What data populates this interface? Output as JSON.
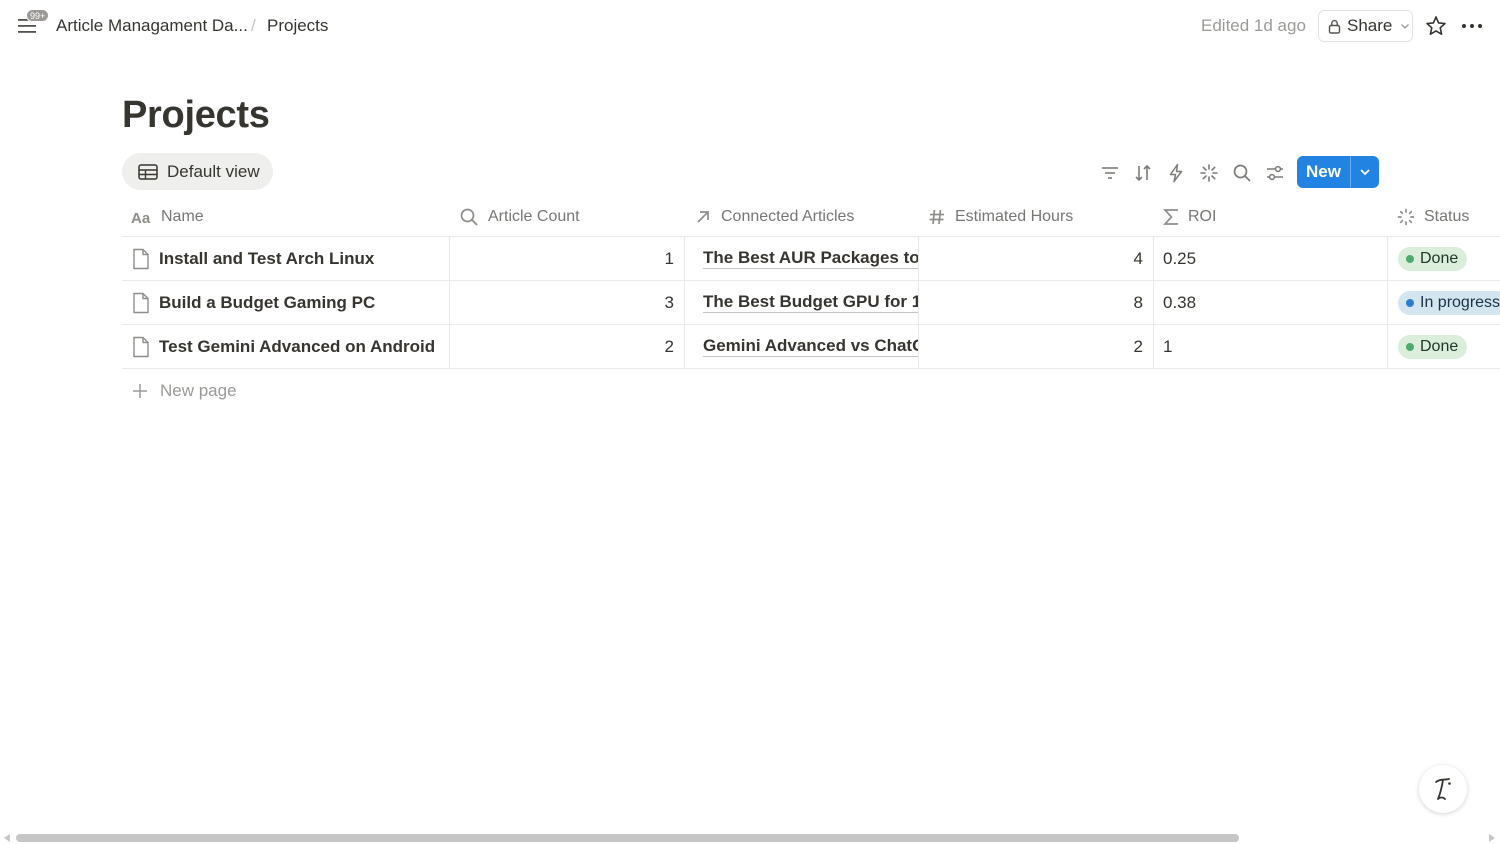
{
  "topbar": {
    "notification_badge": "99+",
    "breadcrumb": [
      "Article Managament Da...",
      "Projects"
    ],
    "separator": "/",
    "edited": "Edited 1d ago",
    "share_label": "Share"
  },
  "page": {
    "title": "Projects",
    "view_label": "Default view"
  },
  "toolbar": {
    "new_label": "New",
    "icons": [
      "filter-icon",
      "sort-icon",
      "automation-icon",
      "ai-sparkle-icon",
      "search-icon",
      "view-settings-icon"
    ],
    "accent_color": "#2383e2"
  },
  "table": {
    "columns": [
      {
        "label": "Name",
        "icon": "text-property-icon"
      },
      {
        "label": "Article Count",
        "icon": "search-icon"
      },
      {
        "label": "Connected Articles",
        "icon": "relation-arrow-icon"
      },
      {
        "label": "Estimated Hours",
        "icon": "number-hash-icon"
      },
      {
        "label": "ROI",
        "icon": "formula-sigma-icon"
      },
      {
        "label": "Status",
        "icon": "status-icon"
      }
    ],
    "rows": [
      {
        "name": "Install and Test Arch Linux",
        "article_count": "1",
        "connected": "The Best AUR Packages to",
        "hours": "4",
        "roi": "0.25",
        "status": "Done"
      },
      {
        "name": "Build a Budget Gaming PC",
        "article_count": "3",
        "connected": "The Best Budget GPU for 1",
        "hours": "8",
        "roi": "0.38",
        "status": "In progress"
      },
      {
        "name": "Test Gemini Advanced on Android",
        "article_count": "2",
        "connected": "Gemini Advanced vs ChatG",
        "hours": "2",
        "roi": "1",
        "status": "Done"
      }
    ],
    "new_page_label": "New page",
    "status_colors": {
      "Done": {
        "bg": "#dbeddb",
        "dot": "#4dab6f",
        "text": "#1c3829"
      },
      "In progress": {
        "bg": "#d3e5ef",
        "dot": "#2e7bd1",
        "text": "#183347"
      }
    }
  }
}
